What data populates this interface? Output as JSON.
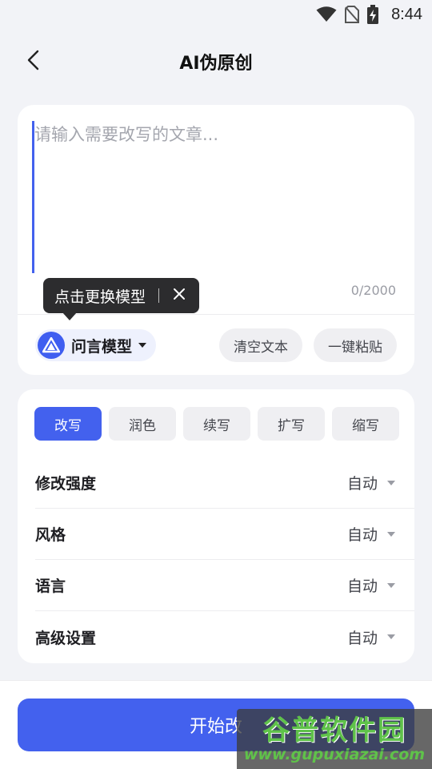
{
  "status_bar": {
    "time": "8:44"
  },
  "header": {
    "title": "AI伪原创"
  },
  "input_card": {
    "placeholder": "请输入需要改写的文章...",
    "char_count": "0/2000",
    "tooltip_text": "点击更换模型",
    "model_name": "问言模型",
    "clear_label": "清空文本",
    "paste_label": "一键粘贴"
  },
  "modes": [
    {
      "label": "改写",
      "active": true
    },
    {
      "label": "润色",
      "active": false
    },
    {
      "label": "续写",
      "active": false
    },
    {
      "label": "扩写",
      "active": false
    },
    {
      "label": "缩写",
      "active": false
    }
  ],
  "options": [
    {
      "label": "修改强度",
      "value": "自动"
    },
    {
      "label": "风格",
      "value": "自动"
    },
    {
      "label": "语言",
      "value": "自动"
    },
    {
      "label": "高级设置",
      "value": "自动"
    }
  ],
  "start_button": {
    "label": "开始改"
  },
  "watermark": {
    "title": "谷普软件园",
    "url": "www.gupuxiazai.com"
  },
  "colors": {
    "accent": "#4361ee",
    "background": "#f2f3f7",
    "tooltip": "#2c2c2e"
  },
  "icons": [
    "wifi-icon",
    "no-sim-icon",
    "battery-charging-icon",
    "back-arrow-icon",
    "close-icon",
    "model-logo-icon",
    "caret-down-icon"
  ]
}
